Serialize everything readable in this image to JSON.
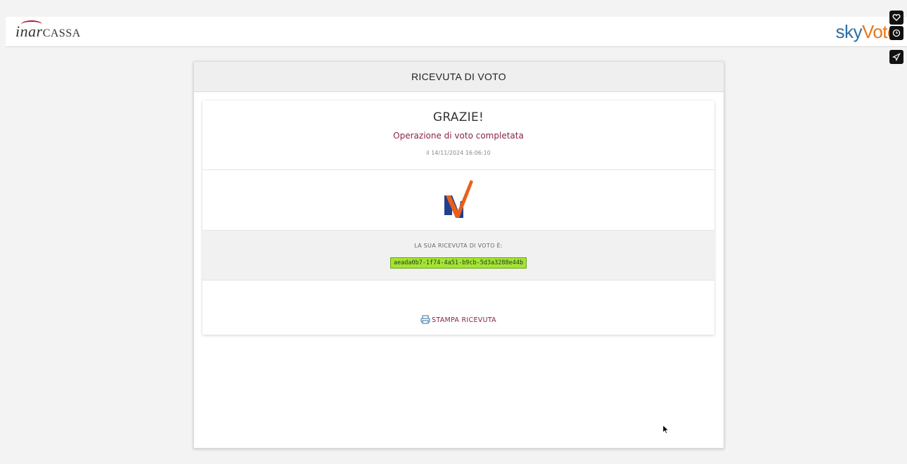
{
  "header": {
    "logo_left_prefix": "inar",
    "logo_left_suffix": "CASSA",
    "logo_right_a": "sky",
    "logo_right_b": "Voto"
  },
  "side_icons": [
    "heart-icon",
    "clock-icon",
    "send-icon"
  ],
  "card": {
    "title": "RICEVUTA DI VOTO",
    "thanks": "GRAZIE!",
    "operation": "Operazione di voto completata",
    "date": "il 14/11/2024 16:06:10",
    "receipt_label": "LA SUA RICEVUTA DI VOTO È:",
    "receipt_code": "aeada0b7-1f74-4a51-b9cb-5d3a3288e44b",
    "print_label": "STAMPA RICEVUTA"
  },
  "colors": {
    "accent": "#8a2440",
    "code_bg": "#a2e630",
    "sky": "#2e6fa8",
    "voto": "#e8771c"
  }
}
